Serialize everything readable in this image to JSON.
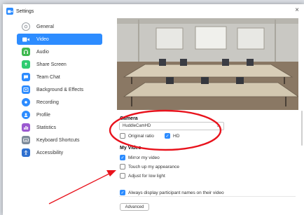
{
  "window": {
    "title": "Settings",
    "close_glyph": "×"
  },
  "sidebar": {
    "items": [
      {
        "label": "General",
        "icon": "gear-icon",
        "color": "#9aa0a6",
        "active": false
      },
      {
        "label": "Video",
        "icon": "video-camera-icon",
        "color": "#ffffff",
        "active": true
      },
      {
        "label": "Audio",
        "icon": "headphones-icon",
        "color": "#3fb950",
        "active": false
      },
      {
        "label": "Share Screen",
        "icon": "share-screen-icon",
        "color": "#2d8cff",
        "active": false
      },
      {
        "label": "Team Chat",
        "icon": "chat-icon",
        "color": "#2d8cff",
        "active": false
      },
      {
        "label": "Background & Effects",
        "icon": "background-icon",
        "color": "#2d8cff",
        "active": false
      },
      {
        "label": "Recording",
        "icon": "record-icon",
        "color": "#2d8cff",
        "active": false
      },
      {
        "label": "Profile",
        "icon": "profile-icon",
        "color": "#2d8cff",
        "active": false
      },
      {
        "label": "Statistics",
        "icon": "statistics-icon",
        "color": "#9b59d0",
        "active": false
      },
      {
        "label": "Keyboard Shortcuts",
        "icon": "keyboard-icon",
        "color": "#7f8c9b",
        "active": false
      },
      {
        "label": "Accessibility",
        "icon": "accessibility-icon",
        "color": "#2d6fcf",
        "active": false
      }
    ]
  },
  "camera": {
    "title": "Camera",
    "selected": "HuddleCamHD",
    "original_ratio_label": "Original ratio",
    "original_ratio_checked": false,
    "hd_label": "HD",
    "hd_checked": true
  },
  "my_video": {
    "title": "My Video",
    "mirror_label": "Mirror my video",
    "mirror_checked": true,
    "touch_up_label": "Touch up my appearance",
    "touch_up_checked": false,
    "low_light_label": "Adjust for low light",
    "low_light_checked": false
  },
  "participants": {
    "always_display_label": "Always display participant names on their video",
    "always_display_checked": true
  },
  "advanced_label": "Advanced",
  "colors": {
    "accent": "#2d8cff",
    "annotation": "#e8121c"
  }
}
